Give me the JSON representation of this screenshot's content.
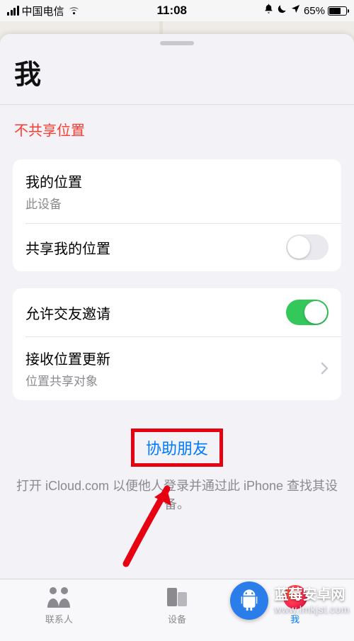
{
  "status": {
    "carrier": "中国电信",
    "time": "11:08",
    "battery_percent": "65%"
  },
  "sheet": {
    "title": "我",
    "not_sharing_label": "不共享位置"
  },
  "group1": {
    "my_location": {
      "title": "我的位置",
      "subtitle": "此设备"
    },
    "share_location": {
      "title": "共享我的位置",
      "on": false
    }
  },
  "group2": {
    "allow_friend_requests": {
      "title": "允许交友邀请",
      "on": true
    },
    "receive_updates": {
      "title": "接收位置更新",
      "subtitle": "位置共享对象"
    }
  },
  "help": {
    "link": "协助朋友",
    "description": "打开 iCloud.com 以便他人登录并通过此 iPhone 查找其设备。"
  },
  "tabs": {
    "people": "联系人",
    "devices": "设备",
    "me": "我"
  },
  "watermark": {
    "line1": "蓝莓安卓网",
    "line2": "www.lmkjst.com"
  }
}
